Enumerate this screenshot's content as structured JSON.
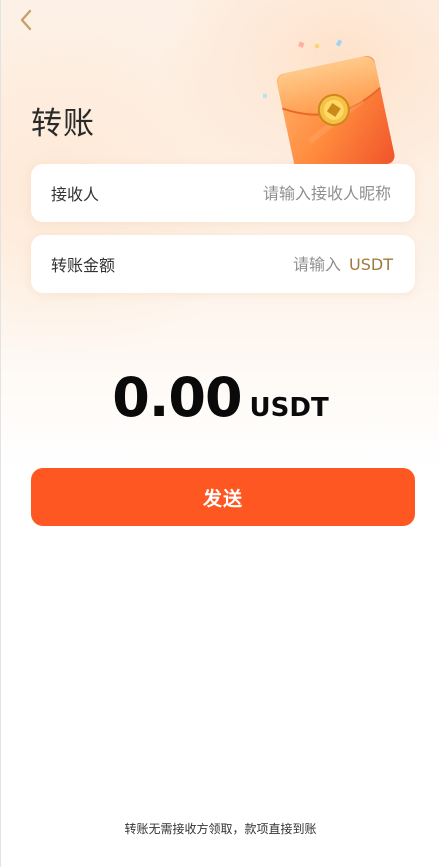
{
  "page": {
    "title": "转账",
    "back_icon": "chevron-left-icon",
    "hero_art": "red-envelope-illustration"
  },
  "form": {
    "recipient": {
      "label": "接收人",
      "placeholder": "请输入接收人昵称",
      "value": ""
    },
    "amount": {
      "label": "转账金额",
      "placeholder": "请输入",
      "unit": "USDT",
      "value": ""
    }
  },
  "summary": {
    "amount": "0.00",
    "unit": "USDT"
  },
  "actions": {
    "send_label": "发送"
  },
  "footer": {
    "note": "转账无需接收方领取，款项直接到账"
  },
  "colors": {
    "accent": "#ff5722",
    "back_icon": "#c9a06a",
    "unit_text": "#a07a3c"
  }
}
